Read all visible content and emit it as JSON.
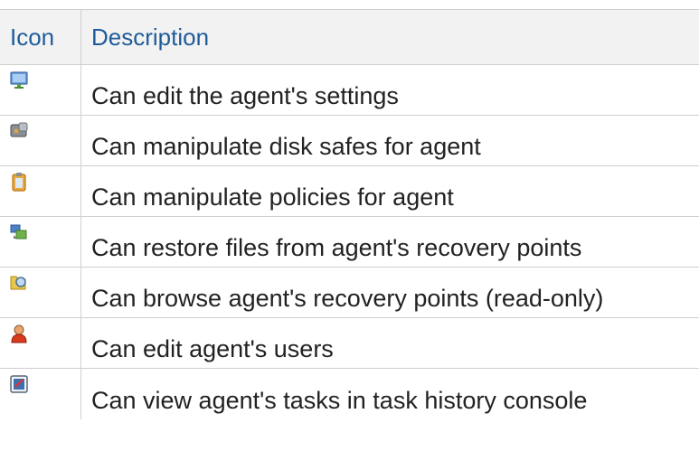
{
  "header": {
    "icon": "Icon",
    "description": "Description"
  },
  "rows": [
    {
      "icon": "monitor-icon",
      "description": "Can edit the agent's settings"
    },
    {
      "icon": "disk-safe-icon",
      "description": "Can manipulate disk safes for agent"
    },
    {
      "icon": "policy-clipboard-icon",
      "description": "Can manipulate policies for agent"
    },
    {
      "icon": "restore-files-icon",
      "description": "Can restore files from agent's recovery points"
    },
    {
      "icon": "browse-recovery-points-icon",
      "description": "Can browse agent's recovery points (read-only)"
    },
    {
      "icon": "user-icon",
      "description": "Can edit agent's users"
    },
    {
      "icon": "task-history-icon",
      "description": "Can view agent's tasks in task history console"
    }
  ],
  "colors": {
    "header_text": "#1f5c99",
    "header_bg": "#f2f2f2",
    "border": "#cfcfcf"
  }
}
